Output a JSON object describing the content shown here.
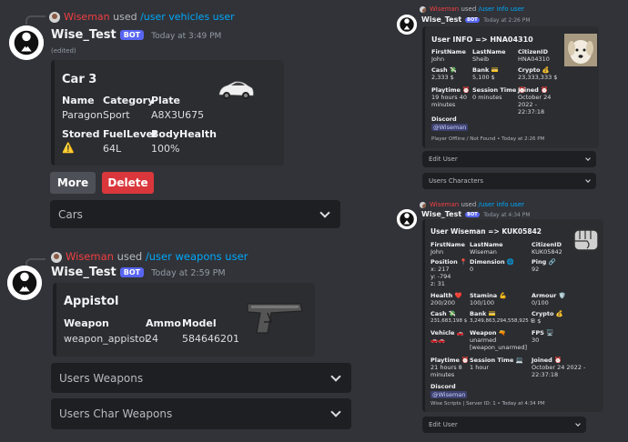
{
  "colors": {
    "bg": "#313338",
    "embed_bg": "#2b2d31",
    "blurple": "#5865f2",
    "danger": "#da373c",
    "secondary": "#4e5058",
    "link": "#00a8fc",
    "reply_name": "#f23f43"
  },
  "msg1": {
    "reply": {
      "name": "Wiseman",
      "used": "used",
      "command": "/user vehicles user"
    },
    "author": "Wise_Test",
    "bot_tag": "BOT",
    "timestamp": "Today at 3:49 PM",
    "edited": "(edited)",
    "embed": {
      "title": "Car 3",
      "fields": [
        {
          "name": "Name",
          "value": "Paragon"
        },
        {
          "name": "Category",
          "value": "Sport"
        },
        {
          "name": "Plate",
          "value": "A8X3U675"
        },
        {
          "name": "Stored",
          "value": "⚠️"
        },
        {
          "name": "FuelLevel",
          "value": "64L"
        },
        {
          "name": "BodyHealth",
          "value": "100%"
        }
      ],
      "thumbnail": "white-sports-car-icon"
    },
    "buttons": {
      "more": "More",
      "delete": "Delete"
    },
    "select": {
      "placeholder": "Cars"
    }
  },
  "msg2": {
    "reply": {
      "name": "Wiseman",
      "used": "used",
      "command": "/user weapons user"
    },
    "author": "Wise_Test",
    "bot_tag": "BOT",
    "timestamp": "Today at 2:59 PM",
    "embed": {
      "title": "Appistol",
      "fields": [
        {
          "name": "Weapon",
          "value": "weapon_appistol"
        },
        {
          "name": "Ammo",
          "value": "24"
        },
        {
          "name": "Model",
          "value": "584646201"
        }
      ],
      "thumbnail": "pistol-icon"
    },
    "selects": [
      "Users Weapons",
      "Users Char Weapons"
    ]
  },
  "rp1": {
    "reply": {
      "name": "Wiseman",
      "used": "used",
      "command": "/user info user"
    },
    "author": "Wise_Test",
    "bot_tag": "BOT",
    "timestamp": "Today at 2:26 PM",
    "title": "User INFO => HNA04310",
    "fields": [
      {
        "name": "FirstName",
        "value": "John"
      },
      {
        "name": "LastName",
        "value": "Sheib"
      },
      {
        "name": "CitizenID",
        "value": "HNA04310"
      },
      {
        "name": "Cash 💸",
        "value": "2,333 $"
      },
      {
        "name": "Bank 💳",
        "value": "5,100 $"
      },
      {
        "name": "Crypto 💰",
        "value": "23,333,333 $"
      },
      {
        "name": "Playtime ⏰",
        "value": "19 hours 40 minutes"
      },
      {
        "name": "Session Time ⏰",
        "value": "0 minutes"
      },
      {
        "name": "Joined ⏰",
        "value": "October 24 2022 - 22:37:18"
      }
    ],
    "discord_label": "Discord",
    "discord_value": "@Wiseman",
    "footer": "Player Offline / Not Found • Today at 2:26 PM",
    "selects": [
      "Edit User",
      "Users Characters"
    ]
  },
  "rp2": {
    "reply": {
      "name": "Wiseman",
      "used": "used",
      "command": "/user info user"
    },
    "author": "Wise_Test",
    "bot_tag": "BOT",
    "timestamp": "Today at 4:34 PM",
    "title": "User Wiseman => KUK05842",
    "fields": [
      {
        "name": "FirstName",
        "value": "John"
      },
      {
        "name": "LastName",
        "value": "Wiseman"
      },
      {
        "name": "CitizenID",
        "value": "KUK05842"
      },
      {
        "name": "Position 📍",
        "value": "x: 217 y: -794 z: 31"
      },
      {
        "name": "Dimension 🌐",
        "value": "0"
      },
      {
        "name": "Ping 🔗",
        "value": "92"
      },
      {
        "name": "Health ❤️",
        "value": "200/200"
      },
      {
        "name": "Stamina 💪",
        "value": "100/100"
      },
      {
        "name": "Armour 🛡️",
        "value": "0/100"
      },
      {
        "name": "Cash 💸",
        "value": "231,683,198 $"
      },
      {
        "name": "Bank 💳",
        "value": "3,249,863,294,558,925 $"
      },
      {
        "name": "Crypto 💰",
        "value": "3 $"
      },
      {
        "name": "Vehicle 🚗",
        "value": "🚗🚗"
      },
      {
        "name": "Weapon 🔫",
        "value": "unarmed [weapon_unarmed]"
      },
      {
        "name": "FPS 🖥️",
        "value": "30"
      },
      {
        "name": "Playtime ⏰",
        "value": "21 hours 8 minutes"
      },
      {
        "name": "Session Time 💻",
        "value": "1 hour"
      },
      {
        "name": "Joined ⏰",
        "value": "October 24 2022 - 22:37:18"
      }
    ],
    "discord_label": "Discord",
    "discord_value": "@Wiseman",
    "footer": "Wise Scripts | Server ID: 1 • Today at 4:34 PM",
    "select": "Edit User"
  }
}
